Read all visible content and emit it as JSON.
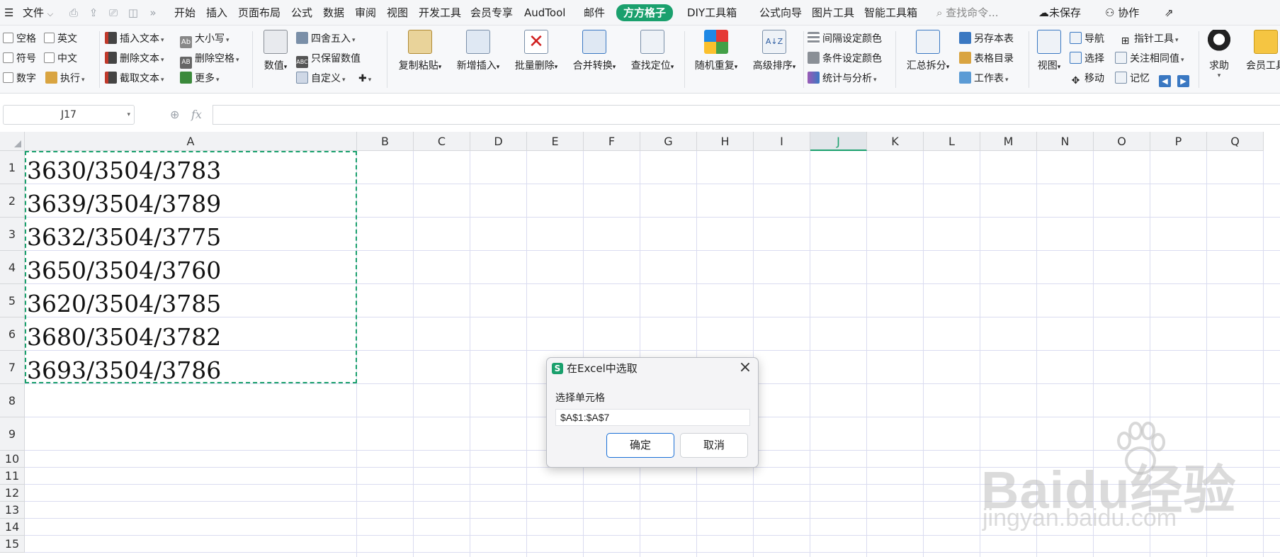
{
  "menubar": {
    "file_label": "文件",
    "tabs": [
      "开始",
      "插入",
      "页面布局",
      "公式",
      "数据",
      "审阅",
      "视图",
      "开发工具",
      "会员专享",
      "AudTool",
      "邮件",
      "方方格子",
      "DIY工具箱",
      "公式向导",
      "图片工具",
      "智能工具箱"
    ],
    "active_tab": "方方格子",
    "search_placeholder": "查找命令...",
    "unsaved_label": "未保存",
    "collab_label": "协作"
  },
  "ribbon": {
    "checkboxes": [
      "空格",
      "英文",
      "符号",
      "中文",
      "数字"
    ],
    "execute_label": "执行",
    "text_group": [
      "插入文本",
      "删除文本",
      "截取文本"
    ],
    "case_group": [
      "大小写",
      "删除空格",
      "更多"
    ],
    "number_label": "数值",
    "number_group": [
      "四舍五入",
      "只保留数值",
      "自定义"
    ],
    "big_buttons": [
      "复制粘贴",
      "新增插入",
      "批量删除",
      "合并转换",
      "查找定位",
      "随机重复",
      "高级排序"
    ],
    "color_group": [
      "间隔设定颜色",
      "条件设定颜色",
      "统计与分析"
    ],
    "summary_split_label": "汇总拆分",
    "sheet_group": [
      "另存本表",
      "表格目录",
      "工作表"
    ],
    "view_label": "视图",
    "nav_group": [
      "导航",
      "选择",
      "移动"
    ],
    "pointer_group": [
      "指针工具",
      "关注相同值",
      "记忆"
    ],
    "help_label": "求助",
    "member_label": "会员工具"
  },
  "formula_bar": {
    "cell_ref": "J17",
    "fx_label": "fx",
    "formula": ""
  },
  "sheet": {
    "columns": [
      "A",
      "B",
      "C",
      "D",
      "E",
      "F",
      "G",
      "H",
      "I",
      "J",
      "K",
      "L",
      "M",
      "N",
      "O",
      "P",
      "Q"
    ],
    "selected_column": "J",
    "row_numbers": [
      "1",
      "2",
      "3",
      "4",
      "5",
      "6",
      "7",
      "8",
      "9",
      "10",
      "11",
      "12",
      "13",
      "14",
      "15"
    ],
    "cells_a": [
      "3630/3504/3783",
      "3639/3504/3789",
      "3632/3504/3775",
      "3650/3504/3760",
      "3620/3504/3785",
      "3680/3504/3782",
      "3693/3504/3786"
    ]
  },
  "dialog": {
    "logo": "S",
    "title": "在Excel中选取",
    "field_label": "选择单元格",
    "field_value": "$A$1:$A$7",
    "ok_label": "确定",
    "cancel_label": "取消"
  },
  "watermark": {
    "main": "Baidu经验",
    "sub": "jingyan.baidu.com"
  },
  "colors": {
    "accent": "#1aa06d",
    "grid_line": "#dadcf0",
    "header_bg": "#f1f2f4",
    "ok_border": "#1a6fd6"
  }
}
